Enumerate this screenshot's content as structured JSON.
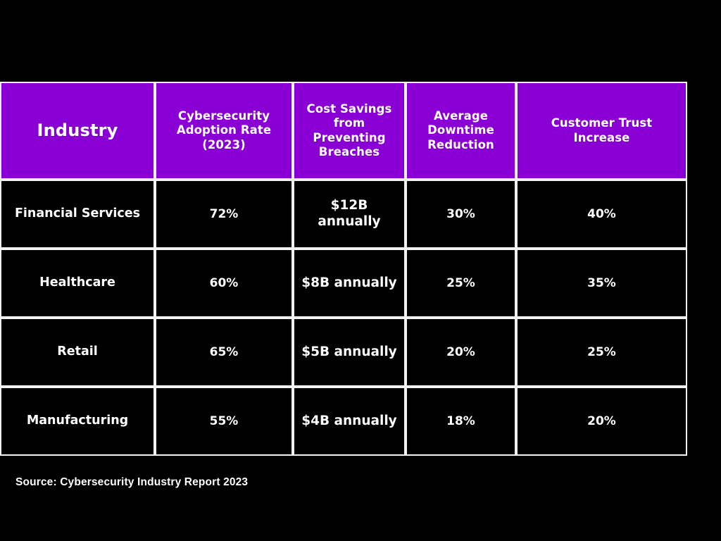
{
  "slide": {
    "background_color": "#000000",
    "header_color": "#8A00D4",
    "border_color": "#F2F2F2",
    "text_color": "#FFFFFF"
  },
  "table": {
    "columns": [
      "Industry",
      "Cybersecurity Adoption Rate (2023)",
      "Cost Savings from Preventing Breaches",
      "Average Downtime Reduction",
      "Customer Trust Increase"
    ],
    "rows": [
      {
        "industry": "Financial Services",
        "adoption_rate": "72%",
        "cost_savings": "$12B annually",
        "downtime_reduction": "30%",
        "trust_increase": "40%"
      },
      {
        "industry": "Healthcare",
        "adoption_rate": "60%",
        "cost_savings": "$8B annually",
        "downtime_reduction": "25%",
        "trust_increase": "35%"
      },
      {
        "industry": "Retail",
        "adoption_rate": "65%",
        "cost_savings": "$5B annually",
        "downtime_reduction": "20%",
        "trust_increase": "25%"
      },
      {
        "industry": "Manufacturing",
        "adoption_rate": "55%",
        "cost_savings": "$4B annually",
        "downtime_reduction": "18%",
        "trust_increase": "20%"
      }
    ]
  },
  "source": {
    "label": "Source: Cybersecurity Industry Report 2023"
  },
  "chart_data": {
    "type": "table",
    "title": "",
    "categories": [
      "Financial Services",
      "Healthcare",
      "Retail",
      "Manufacturing"
    ],
    "series": [
      {
        "name": "Cybersecurity Adoption Rate (2023)",
        "values": [
          72,
          60,
          65,
          55
        ],
        "unit": "%"
      },
      {
        "name": "Cost Savings from Preventing Breaches",
        "values": [
          12,
          8,
          5,
          4
        ],
        "unit": "B USD annually"
      },
      {
        "name": "Average Downtime Reduction",
        "values": [
          30,
          25,
          20,
          18
        ],
        "unit": "%"
      },
      {
        "name": "Customer Trust Increase",
        "values": [
          40,
          35,
          25,
          20
        ],
        "unit": "%"
      }
    ],
    "annotations": [
      "Source: Cybersecurity Industry Report 2023"
    ]
  }
}
